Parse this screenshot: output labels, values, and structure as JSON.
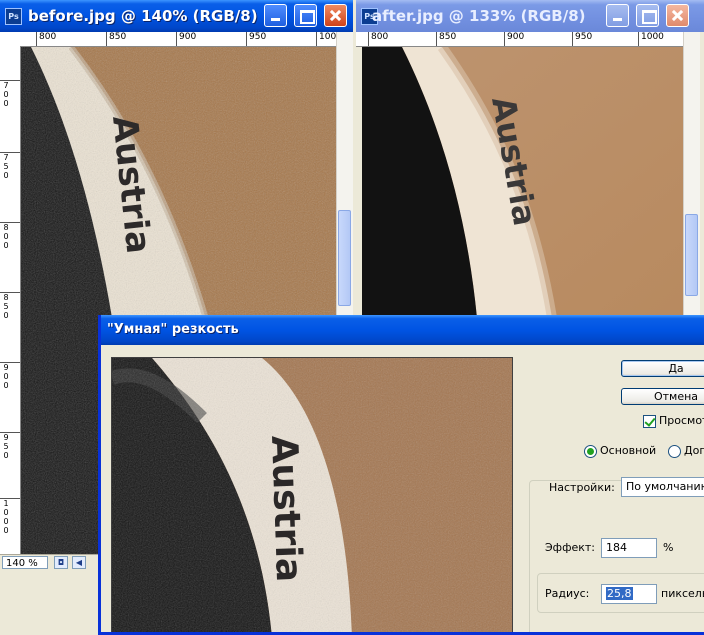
{
  "window_before": {
    "title": "before.jpg @ 140% (RGB/8)",
    "ruler_h": [
      "800",
      "850",
      "900",
      "950",
      "100"
    ],
    "ruler_v": [
      "7\n0\n0",
      "7\n5\n0",
      "8\n0\n0",
      "8\n5\n0",
      "9\n0\n0",
      "9\n5\n0",
      "1\n0\n0\n0",
      "1\n0\n5"
    ],
    "zoom": "140 %",
    "photo_text": "Austria"
  },
  "window_after": {
    "title": "after.jpg @ 133% (RGB/8)",
    "ruler_h": [
      "800",
      "850",
      "900",
      "950",
      "1000"
    ],
    "photo_text": "Austria"
  },
  "dialog": {
    "title": "\"Умная\" резкость",
    "ok_label": "Да",
    "cancel_label": "Отмена",
    "preview_label": "Просмот",
    "radio_basic": "Основной",
    "radio_extra": "Доп",
    "settings_label": "Настройки:",
    "settings_value": "По умолчанию",
    "effect_label": "Эффект:",
    "effect_value": "184",
    "effect_unit": "%",
    "radius_label": "Радиус:",
    "radius_value": "25,8",
    "radius_unit": "пиксель",
    "photo_text": "Austria"
  },
  "colors": {
    "xp_blue": "#0054e3",
    "photo_brown": "#a6774a",
    "rim": "#ece3d3"
  }
}
